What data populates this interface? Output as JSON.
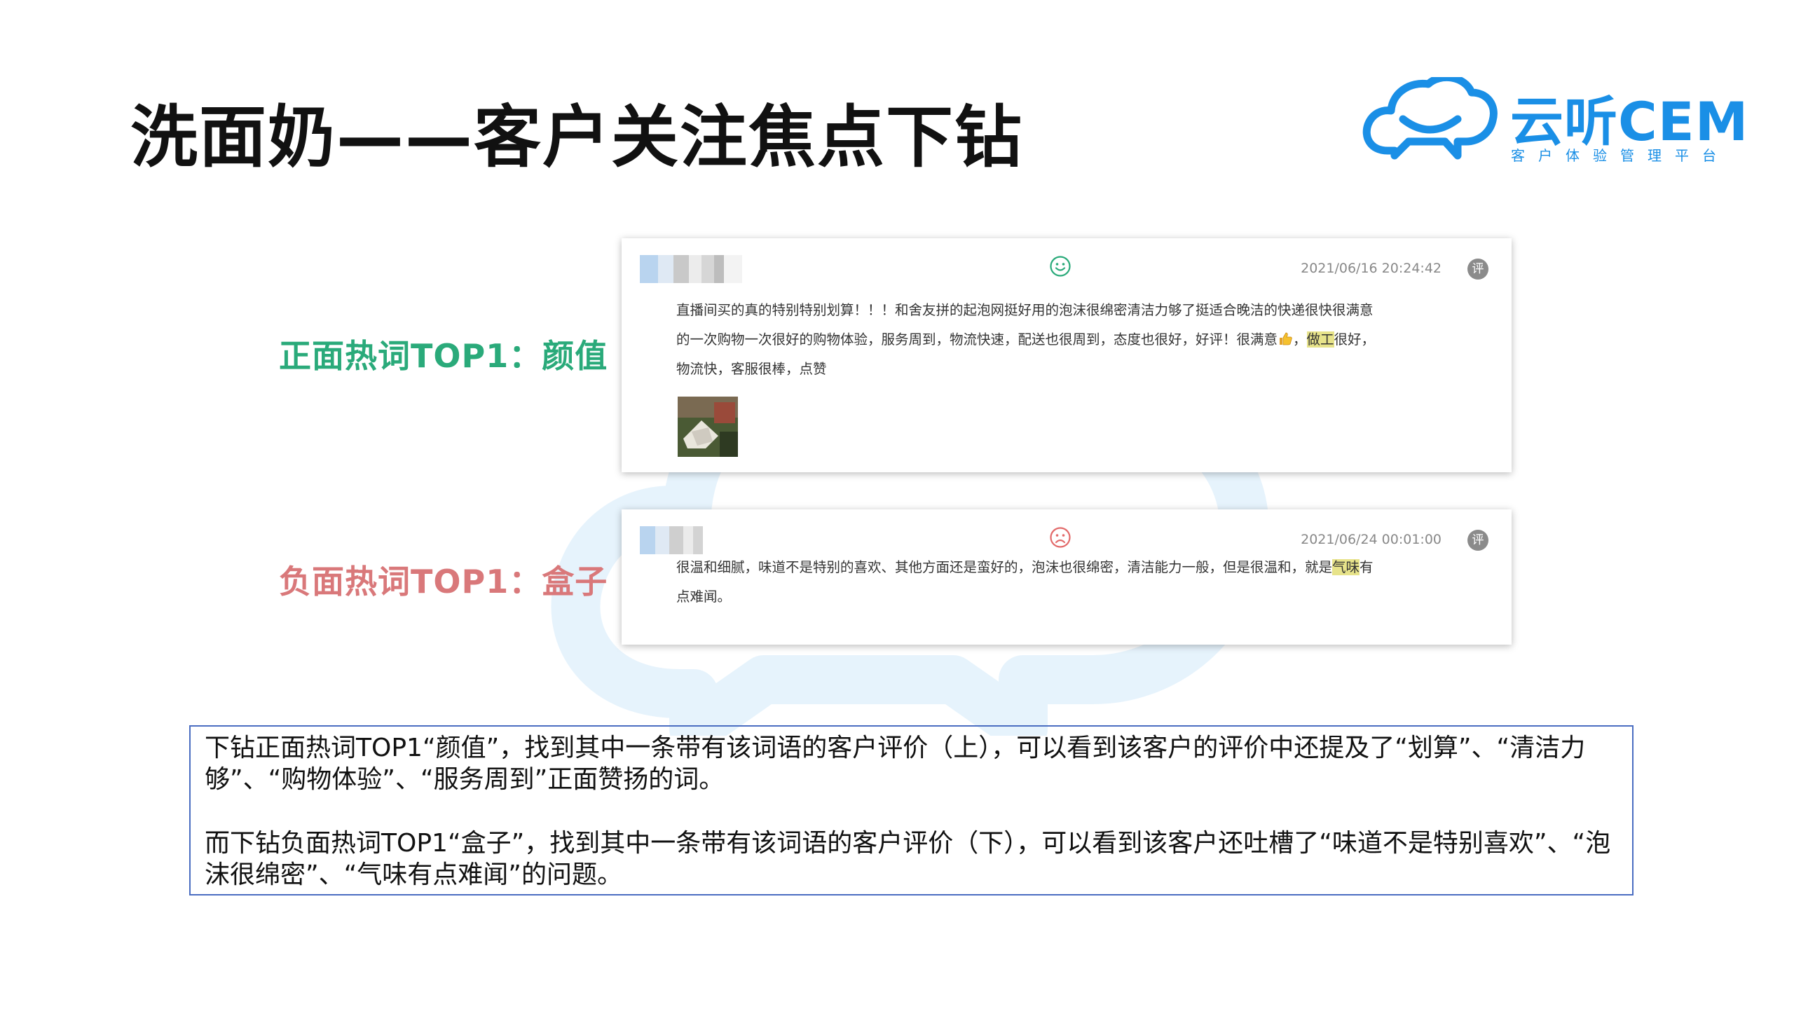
{
  "slide": {
    "title": "洗面奶——客户关注焦点下钻",
    "logo": {
      "name": "云听CEM",
      "subtitle": "客户体验管理平台"
    }
  },
  "hot_words": {
    "positive_label": "正面热词TOP1：颜值",
    "negative_label": "负面热词TOP1：盒子"
  },
  "reviews": [
    {
      "sentiment_icon": "smile-face-icon",
      "timestamp": "2021/06/16 20:24:42",
      "badge": "评",
      "text_before": "直播间买的真的特别特别划算！！！和舍友拼的起泡网挺好用的泡沫很绵密清洁力够了挺适合晚洁的快递很快很满意的一次购物一次很好的购物体验，服务周到，物流快速，配送也很周到，态度也很好，好评！很满意",
      "emoji_icon": "thumbs-up-icon",
      "text_mid": "，",
      "highlight": "做工",
      "text_after": "很好，物流快，客服很棒，点赞",
      "has_photo": true
    },
    {
      "sentiment_icon": "sad-face-icon",
      "timestamp": "2021/06/24 00:01:00",
      "badge": "评",
      "text_before": "很温和细腻，味道不是特别的喜欢、其他方面还是蛮好的，泡沫也很绵密，清洁能力一般，但是很温和，就是",
      "highlight": "气味",
      "text_after": "有点难闻。"
    }
  ],
  "summary": {
    "paragraph1": "下钻正面热词TOP1“颜值”，找到其中一条带有该词语的客户评价（上），可以看到该客户的评价中还提及了“划算”、“清洁力够”、“购物体验”、“服务周到”正面赞扬的词。",
    "paragraph2": "而下钻负面热词TOP1“盒子”，找到其中一条带有该词语的客户评价（下），可以看到该客户还吐槽了“味道不是特别喜欢”、“泡沫很绵密”、“气味有点难闻”的问题。"
  },
  "colors": {
    "positive": "#2aaa7a",
    "negative": "#d9787a",
    "brand": "#1a8fe6",
    "highlight": "#e7e38a",
    "box_border": "#4a6dc1"
  }
}
